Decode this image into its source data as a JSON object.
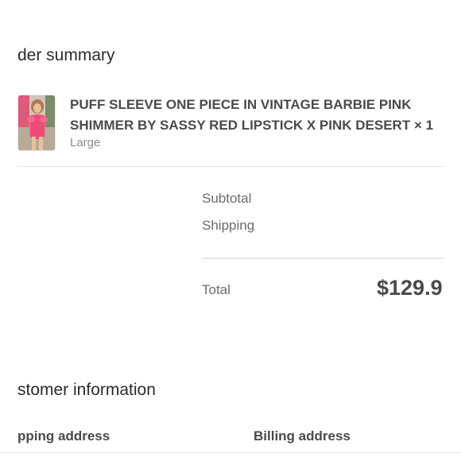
{
  "order_summary": {
    "title": "der summary",
    "product": {
      "name": "PUFF SLEEVE ONE PIECE IN VINTAGE BARBIE PINK SHIMMER BY SASSY RED LIPSTICK X PINK DESERT × 1",
      "variant": "Large",
      "image": "product-photo"
    },
    "subtotal_label": "Subtotal",
    "shipping_label": "Shipping",
    "total_label": "Total",
    "total_value": "$129.9"
  },
  "customer_info": {
    "title": "stomer information",
    "shipping_address_heading": "pping address",
    "billing_address_heading": "Billing address"
  },
  "colors": {
    "text_dark": "#2b2b2b",
    "text_muted": "#8a8a8a",
    "divider": "#e6e6e6",
    "swimsuit_pink": "#f04a78"
  }
}
